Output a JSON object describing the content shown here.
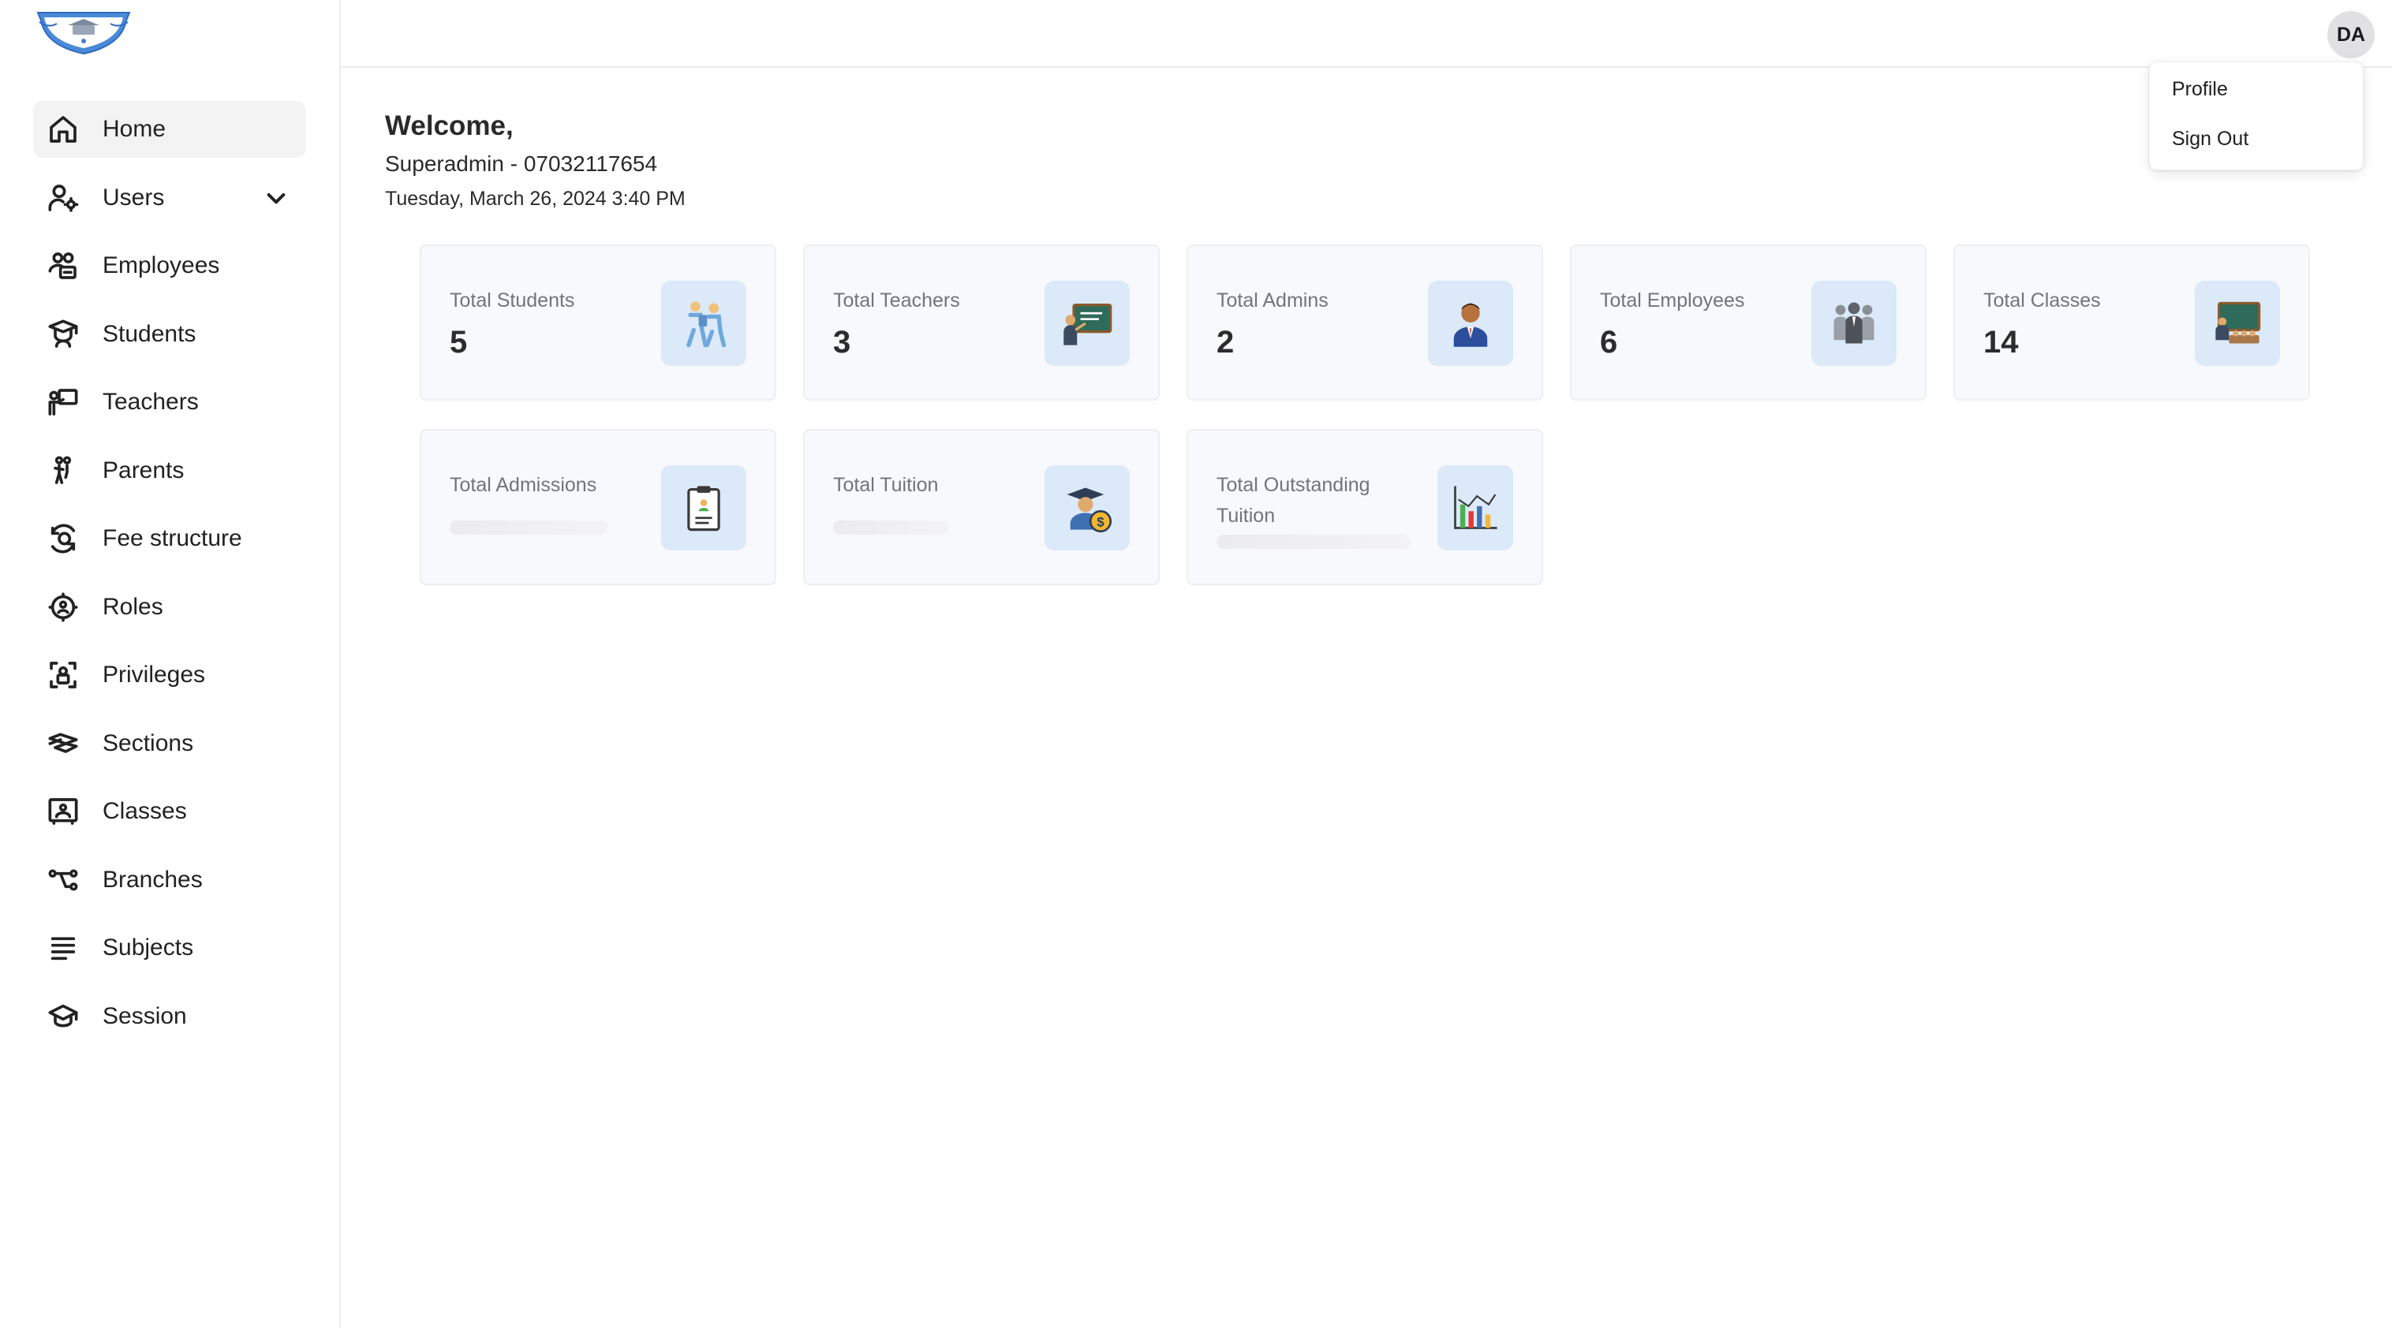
{
  "sidebar": {
    "items": [
      {
        "label": "Home",
        "icon": "home-icon",
        "active": true
      },
      {
        "label": "Users",
        "icon": "user-gear-icon",
        "expandable": true
      },
      {
        "label": "Employees",
        "icon": "employees-icon"
      },
      {
        "label": "Students",
        "icon": "student-icon"
      },
      {
        "label": "Teachers",
        "icon": "teacher-icon"
      },
      {
        "label": "Parents",
        "icon": "parents-icon"
      },
      {
        "label": "Fee structure",
        "icon": "fee-icon"
      },
      {
        "label": "Roles",
        "icon": "roles-icon"
      },
      {
        "label": "Privileges",
        "icon": "privileges-icon"
      },
      {
        "label": "Sections",
        "icon": "sections-icon"
      },
      {
        "label": "Classes",
        "icon": "classes-icon"
      },
      {
        "label": "Branches",
        "icon": "branches-icon"
      },
      {
        "label": "Subjects",
        "icon": "subjects-icon"
      },
      {
        "label": "Session",
        "icon": "session-icon"
      }
    ]
  },
  "header": {
    "avatar_initials": "DA",
    "menu": {
      "profile": "Profile",
      "sign_out": "Sign Out"
    }
  },
  "main": {
    "welcome": "Welcome,",
    "user_line": "Superadmin - 07032117654",
    "date_line": "Tuesday, March 26, 2024 3:40 PM"
  },
  "cards": [
    {
      "title": "Total Students",
      "value": "5",
      "icon": "students-walking-icon"
    },
    {
      "title": "Total Teachers",
      "value": "3",
      "icon": "teacher-board-icon"
    },
    {
      "title": "Total Admins",
      "value": "2",
      "icon": "admin-person-icon"
    },
    {
      "title": "Total Employees",
      "value": "6",
      "icon": "employees-group-icon"
    },
    {
      "title": "Total Classes",
      "value": "14",
      "icon": "classroom-icon"
    },
    {
      "title": "Total Admissions",
      "value": "",
      "icon": "clipboard-icon",
      "loading": true
    },
    {
      "title": "Total Tuition",
      "value": "",
      "icon": "graduate-money-icon",
      "loading": true
    },
    {
      "title": "Total Outstanding Tuition",
      "value": "",
      "icon": "bar-chart-icon",
      "loading": true
    }
  ],
  "colors": {
    "card_bg": "#f8f9fc",
    "icon_bg": "#dbe9f8",
    "active_nav_bg": "#f3f3f4",
    "logo_blue": "#3f7fd1"
  }
}
